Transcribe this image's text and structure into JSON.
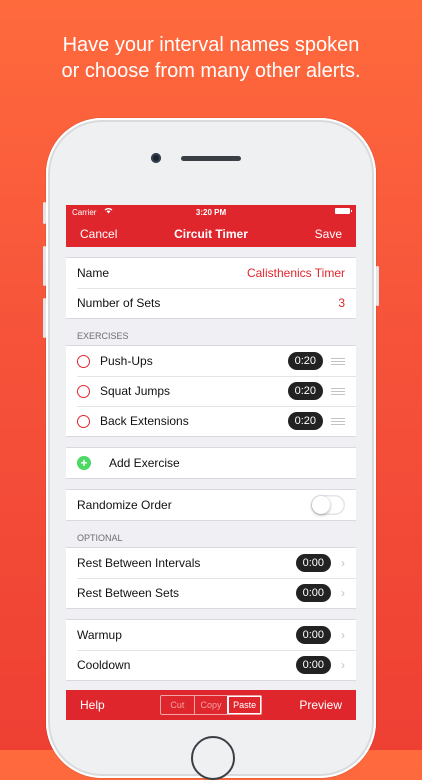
{
  "headline": {
    "line1": "Have your interval names spoken",
    "line2": "or choose from many other alerts."
  },
  "status_bar": {
    "carrier": "Carrier",
    "wifi_icon": "wifi-icon",
    "time": "3:20 PM",
    "battery_icon": "battery-icon"
  },
  "nav": {
    "cancel_label": "Cancel",
    "title": "Circuit Timer",
    "save_label": "Save"
  },
  "settings": {
    "name_label": "Name",
    "name_value": "Calisthenics Timer",
    "sets_label": "Number of Sets",
    "sets_value": "3"
  },
  "exercises": {
    "header": "EXERCISES",
    "items": [
      {
        "name": "Push-Ups",
        "duration": "0:20"
      },
      {
        "name": "Squat Jumps",
        "duration": "0:20"
      },
      {
        "name": "Back Extensions",
        "duration": "0:20"
      }
    ],
    "add_label": "Add Exercise"
  },
  "randomize": {
    "label": "Randomize Order",
    "enabled": false
  },
  "optional": {
    "header": "OPTIONAL",
    "rest_intervals_label": "Rest Between Intervals",
    "rest_intervals_value": "0:00",
    "rest_sets_label": "Rest Between Sets",
    "rest_sets_value": "0:00",
    "warmup_label": "Warmup",
    "warmup_value": "0:00",
    "cooldown_label": "Cooldown",
    "cooldown_value": "0:00"
  },
  "toolbar": {
    "help_label": "Help",
    "cut_label": "Cut",
    "copy_label": "Copy",
    "paste_label": "Paste",
    "preview_label": "Preview"
  },
  "colors": {
    "accent": "#e0262d",
    "toggle_on": "#4cd964",
    "pill": "#222222"
  }
}
